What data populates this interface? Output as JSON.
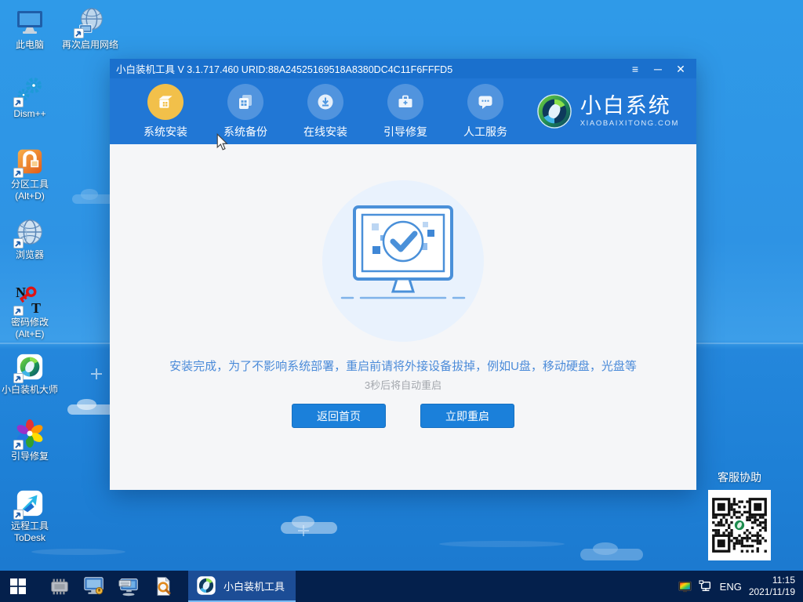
{
  "desktop": {
    "icons": [
      {
        "id": "this-pc",
        "label": "此电脑"
      },
      {
        "id": "re-enable-network",
        "label": "再次启用网络"
      },
      {
        "id": "dism",
        "label": "Dism++"
      },
      {
        "id": "partition-tool",
        "label": "分区工具",
        "label2": "(Alt+D)"
      },
      {
        "id": "browser",
        "label": "浏览器"
      },
      {
        "id": "password-reset",
        "label": "密码修改",
        "label2": "(Alt+E)"
      },
      {
        "id": "xiaobai-master",
        "label": "小白装机大师"
      },
      {
        "id": "boot-repair",
        "label": "引导修复"
      },
      {
        "id": "remote-tool",
        "label": "远程工具",
        "label2": "ToDesk"
      }
    ]
  },
  "window": {
    "title": "小白装机工具 V 3.1.717.460 URID:88A24525169518A8380DC4C11F6FFFD5",
    "controls": {
      "menu": "≡",
      "minimize": "─",
      "close": "✕"
    },
    "tabs": [
      {
        "label": "系统安装",
        "icon": "package-icon",
        "active": true
      },
      {
        "label": "系统备份",
        "icon": "backup-icon",
        "active": false
      },
      {
        "label": "在线安装",
        "icon": "download-icon",
        "active": false
      },
      {
        "label": "引导修复",
        "icon": "toolbox-icon",
        "active": false
      },
      {
        "label": "人工服务",
        "icon": "chat-icon",
        "active": false
      }
    ],
    "logo": {
      "title": "小白系统",
      "subtitle": "XIAOBAIXITONG.COM"
    },
    "main": {
      "message": "安装完成，为了不影响系统部署，重启前请将外接设备拔掉，例如U盘，移动硬盘，光盘等",
      "countdown": "3秒后将自动重启",
      "buttons": [
        {
          "label": "返回首页"
        },
        {
          "label": "立即重启"
        }
      ]
    }
  },
  "qr": {
    "label": "客服协助"
  },
  "taskbar": {
    "app_label": "小白装机工具",
    "tray": {
      "language": "ENG",
      "time": "11:15",
      "date": "2021/11/19"
    }
  },
  "colors": {
    "header_blue": "#2177d5",
    "titlebar_blue": "#1a70cd",
    "active_tab_yellow": "#f2c04a",
    "button_blue": "#1b80da",
    "message_blue": "#4b8bd9",
    "taskbar_navy": "#04204c"
  }
}
